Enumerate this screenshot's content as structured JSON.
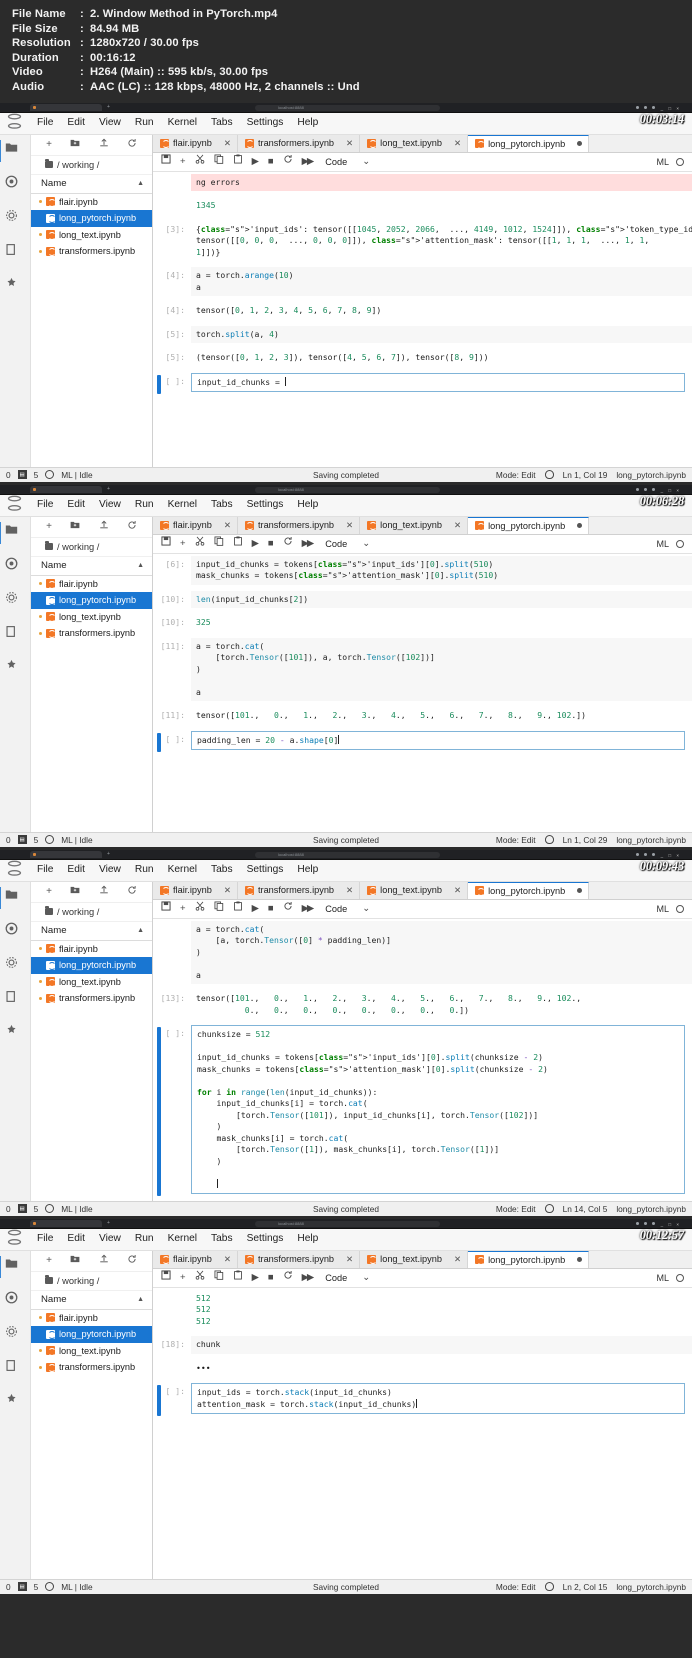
{
  "fileinfo": {
    "rows": [
      {
        "label": "File Name",
        "value": "2. Window Method in PyTorch.mp4"
      },
      {
        "label": "File Size",
        "value": "84.94 MB"
      },
      {
        "label": "Resolution",
        "value": "1280x720 / 30.00 fps"
      },
      {
        "label": "Duration",
        "value": "00:16:12"
      },
      {
        "label": "Video",
        "value": "H264 (Main) :: 595 kb/s, 30.00 fps"
      },
      {
        "label": "Audio",
        "value": "AAC (LC) :: 128 kbps, 48000 Hz, 2 channels :: Und"
      }
    ],
    "colon": ":"
  },
  "common": {
    "menu": [
      "File",
      "Edit",
      "View",
      "Run",
      "Kernel",
      "Tabs",
      "Settings",
      "Help"
    ],
    "sidebar_toolbar": [
      "+",
      "new-folder-icon",
      "upload-icon",
      "refresh-icon"
    ],
    "breadcrumb": "/ working /",
    "name_header": "Name",
    "sort_caret": "▲",
    "files": [
      {
        "name": "flair.ipynb",
        "active": false
      },
      {
        "name": "long_pytorch.ipynb",
        "active": true
      },
      {
        "name": "long_text.ipynb",
        "active": false
      },
      {
        "name": "transformers.ipynb",
        "active": false
      }
    ],
    "tabs": [
      {
        "label": "flair.ipynb",
        "active": false,
        "dirty": false
      },
      {
        "label": "transformers.ipynb",
        "active": false,
        "dirty": false
      },
      {
        "label": "long_text.ipynb",
        "active": false,
        "dirty": false
      },
      {
        "label": "long_pytorch.ipynb",
        "active": true,
        "dirty": true
      }
    ],
    "toolbar": {
      "save": "save-icon",
      "add": "+",
      "cut": "scissors-icon",
      "copy": "copy-icon",
      "paste": "paste-icon",
      "run": "▶",
      "stop": "■",
      "restart": "restart-icon",
      "fastforward": "▶▶",
      "celltype": "Code",
      "chevron": "⌄",
      "kernel": "ML"
    },
    "status": {
      "left_count": "0",
      "tab_count": "5",
      "kernel_state": "ML | Idle",
      "center": "Saving completed",
      "mode": "Mode: Edit",
      "filename": "long_pytorch.ipynb"
    },
    "url_text": "localhost:8888"
  },
  "panels": [
    {
      "timestamp": "00:03:14",
      "cursor": "Ln 1, Col 19",
      "cells": [
        {
          "type": "err_top",
          "prompt": "",
          "lines": [
            "ng errors"
          ]
        },
        {
          "type": "plain",
          "prompt": "",
          "lines": [
            "1345"
          ]
        },
        {
          "type": "output",
          "prompt": "[3]:",
          "lines": [
            "{'input_ids': tensor([[1045, 2052, 2066,  ..., 4149, 1012, 1524]]), 'token_type_ids':",
            "tensor([[0, 0, 0,  ..., 0, 0, 0]]), 'attention_mask': tensor([[1, 1, 1,  ..., 1, 1,",
            "1]])}"
          ]
        },
        {
          "type": "input",
          "prompt": "[4]:",
          "lines": [
            "a = torch.arange(10)",
            "a"
          ]
        },
        {
          "type": "output",
          "prompt": "[4]:",
          "lines": [
            "tensor([0, 1, 2, 3, 4, 5, 6, 7, 8, 9])"
          ]
        },
        {
          "type": "input",
          "prompt": "[5]:",
          "lines": [
            "torch.split(a, 4)"
          ]
        },
        {
          "type": "output",
          "prompt": "[5]:",
          "lines": [
            "(tensor([0, 1, 2, 3]), tensor([4, 5, 6, 7]), tensor([8, 9]))"
          ]
        },
        {
          "type": "editing",
          "prompt": "[ ]:",
          "lines": [
            "input_id_chunks = "
          ]
        }
      ]
    },
    {
      "timestamp": "00:06:28",
      "cursor": "Ln 1, Col 29",
      "cells": [
        {
          "type": "input",
          "prompt": "[6]:",
          "lines": [
            "input_id_chunks = tokens['input_ids'][0].split(510)",
            "mask_chunks = tokens['attention_mask'][0].split(510)"
          ]
        },
        {
          "type": "input",
          "prompt": "[10]:",
          "lines": [
            "len(input_id_chunks[2])"
          ]
        },
        {
          "type": "output",
          "prompt": "[10]:",
          "lines": [
            "325"
          ]
        },
        {
          "type": "input",
          "prompt": "[11]:",
          "lines": [
            "a = torch.cat(",
            "    [torch.Tensor([101]), a, torch.Tensor([102])]",
            ")",
            "",
            "a"
          ]
        },
        {
          "type": "output",
          "prompt": "[11]:",
          "lines": [
            "tensor([101.,   0.,   1.,   2.,   3.,   4.,   5.,   6.,   7.,   8.,   9., 102.])"
          ]
        },
        {
          "type": "editing",
          "prompt": "[ ]:",
          "lines": [
            "padding_len = 20 - a.shape[0]"
          ]
        }
      ]
    },
    {
      "timestamp": "00:09:43",
      "cursor": "Ln 14, Col 5",
      "cells": [
        {
          "type": "input",
          "prompt": "",
          "lines": [
            "a = torch.cat(",
            "    [a, torch.Tensor([0] * padding_len)]",
            ")",
            "",
            "a"
          ]
        },
        {
          "type": "output",
          "prompt": "[13]:",
          "lines": [
            "tensor([101.,   0.,   1.,   2.,   3.,   4.,   5.,   6.,   7.,   8.,   9., 102.,",
            "          0.,   0.,   0.,   0.,   0.,   0.,   0.,   0.])"
          ]
        },
        {
          "type": "editing",
          "prompt": "[ ]:",
          "lines": [
            "chunksize = 512",
            "",
            "input_id_chunks = tokens['input_ids'][0].split(chunksize - 2)",
            "mask_chunks = tokens['attention_mask'][0].split(chunksize - 2)",
            "",
            "for i in range(len(input_id_chunks)):",
            "    input_id_chunks[i] = torch.cat(",
            "        [torch.Tensor([101]), input_id_chunks[i], torch.Tensor([102])]",
            "    )",
            "    mask_chunks[i] = torch.cat(",
            "        [torch.Tensor([1]), mask_chunks[i], torch.Tensor([1])]",
            "    )",
            "",
            "    "
          ]
        }
      ]
    },
    {
      "timestamp": "00:12:57",
      "cursor": "Ln 2, Col 15",
      "cells": [
        {
          "type": "plain",
          "prompt": "",
          "lines": [
            "512",
            "512",
            "512"
          ]
        },
        {
          "type": "input",
          "prompt": "[18]:",
          "lines": [
            "chunk"
          ]
        },
        {
          "type": "plain",
          "prompt": "",
          "lines": [
            "•••"
          ]
        },
        {
          "type": "editing",
          "prompt": "[ ]:",
          "lines": [
            "input_ids = torch.stack(input_id_chunks)",
            "attention_mask = torch.stack(input_id_chunks)"
          ]
        }
      ]
    }
  ],
  "colors": {
    "accent": "#1976d2",
    "jupyter_orange": "#f37726",
    "error_bg": "#ffdddd",
    "panel_bg": "#2b2b2b"
  }
}
